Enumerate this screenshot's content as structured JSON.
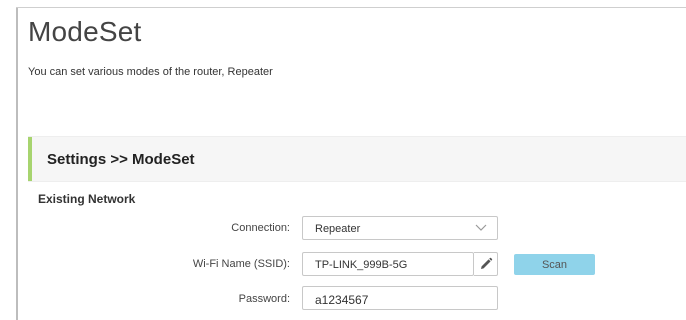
{
  "page": {
    "title": "ModeSet",
    "description": "You can set various modes of the router, Repeater"
  },
  "section": {
    "title": "Settings >> ModeSet",
    "accent_color": "#a7d46f"
  },
  "existing_network": {
    "title": "Existing Network",
    "connection": {
      "label": "Connection:",
      "value": "Repeater",
      "icon": "chevron-down-icon"
    },
    "ssid": {
      "label": "Wi-Fi Name (SSID):",
      "value": "TP-LINK_999B-5G",
      "edit_icon": "pencil-icon"
    },
    "scan": {
      "label": "Scan",
      "color": "#8fd3ea"
    },
    "password": {
      "label": "Password:",
      "value": "a1234567"
    }
  }
}
